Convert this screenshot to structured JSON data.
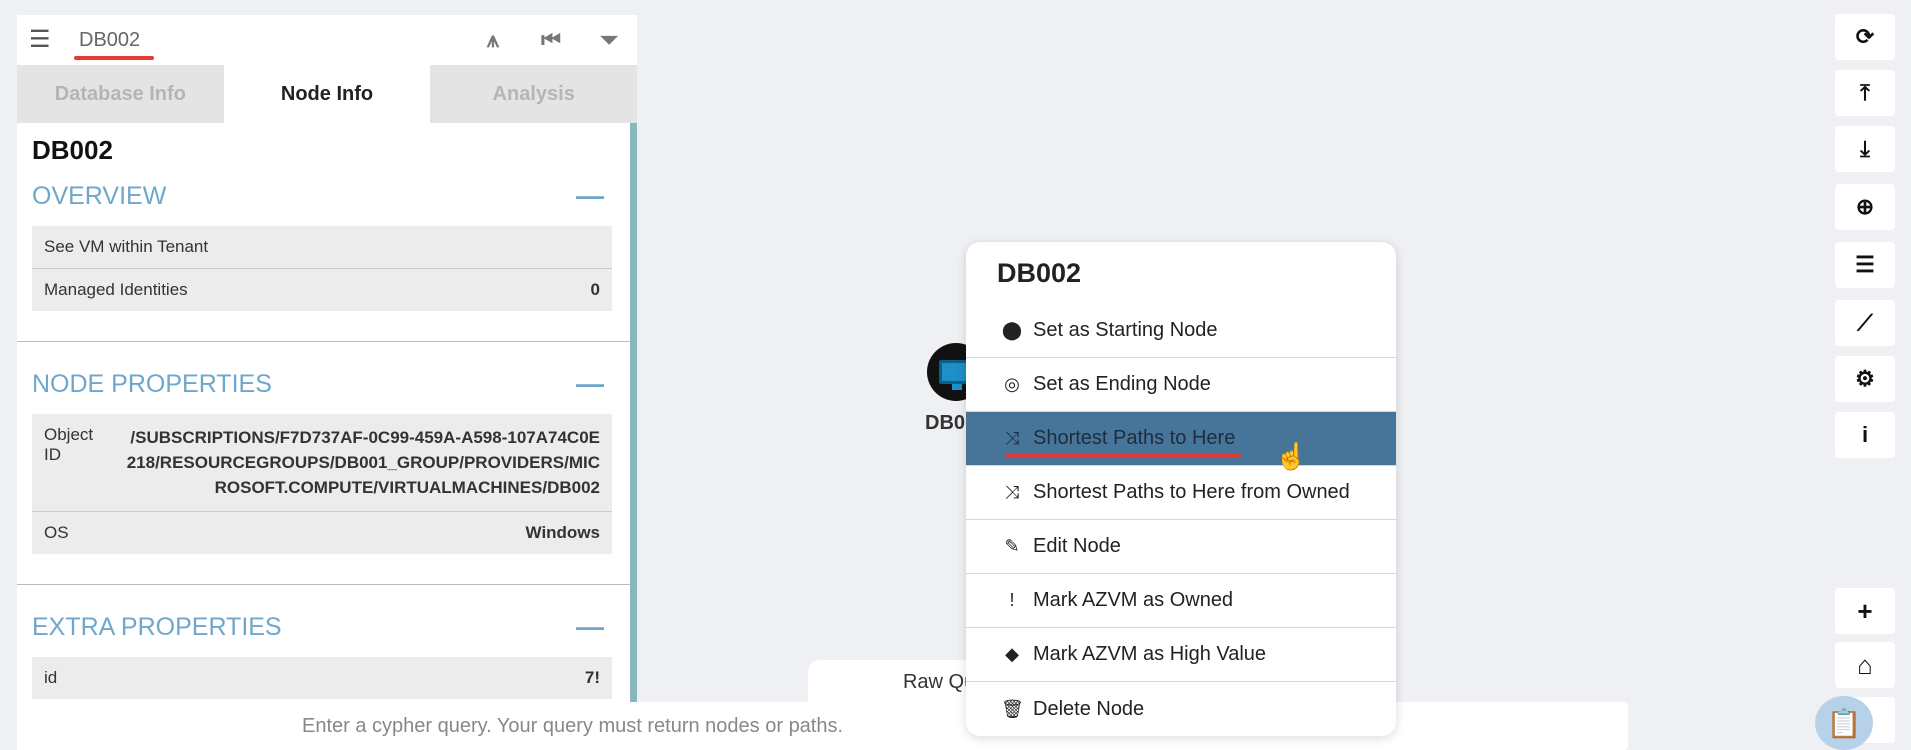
{
  "search": {
    "value": "DB002"
  },
  "toolbar_icons": [
    "route-icon",
    "skip-back-icon",
    "filter-icon"
  ],
  "tabs": [
    "Database Info",
    "Node Info",
    "Analysis"
  ],
  "active_tab": "Node Info",
  "node": {
    "title": "DB002",
    "overview": {
      "title": "OVERVIEW",
      "rows": [
        {
          "label": "See VM within Tenant",
          "value": ""
        },
        {
          "label": "Managed Identities",
          "value": "0"
        }
      ]
    },
    "node_properties": {
      "title": "NODE PROPERTIES",
      "object_id_label": "Object ID",
      "object_id_value": "/SUBSCRIPTIONS/F7D737AF-0C99-459A-A598-107A74C0E218/RESOURCEGROUPS/DB001_GROUP/PROVIDERS/MICROSOFT.COMPUTE/VIRTUALMACHINES/DB002",
      "os_label": "OS",
      "os_value": "Windows"
    },
    "extra_properties": {
      "title": "EXTRA PROPERTIES",
      "id_label": "id",
      "id_value": "7!"
    },
    "collapse_symbol": "—"
  },
  "graph_node": {
    "label": "DB0"
  },
  "context_menu": {
    "title": "DB002",
    "items": [
      {
        "label": "Set as Starting Node",
        "icon": "map-marker-icon"
      },
      {
        "label": "Set as Ending Node",
        "icon": "bullseye-icon"
      },
      {
        "label": "Shortest Paths to Here",
        "icon": "shuffle-icon"
      },
      {
        "label": "Shortest Paths to Here from Owned",
        "icon": "shuffle-icon"
      },
      {
        "label": "Edit Node",
        "icon": "edit-icon"
      },
      {
        "label": "Mark AZVM as Owned",
        "icon": "exclamation-icon"
      },
      {
        "label": "Mark AZVM as High Value",
        "icon": "gem-icon"
      },
      {
        "label": "Delete Node",
        "icon": "trash-icon"
      }
    ],
    "highlighted_index": 2
  },
  "raw_query": {
    "label": "Raw Query"
  },
  "query_input": {
    "placeholder": "Enter a cypher query. Your query must return nodes or paths."
  },
  "right_toolbar": [
    "refresh-icon",
    "upload-icon",
    "download-icon",
    "upload-circle-icon",
    "tasks-icon",
    "chart-icon",
    "cogs-icon",
    "info-icon"
  ],
  "zoom_controls": [
    "zoom-in-icon",
    "home-icon",
    "zoom-out-icon"
  ]
}
